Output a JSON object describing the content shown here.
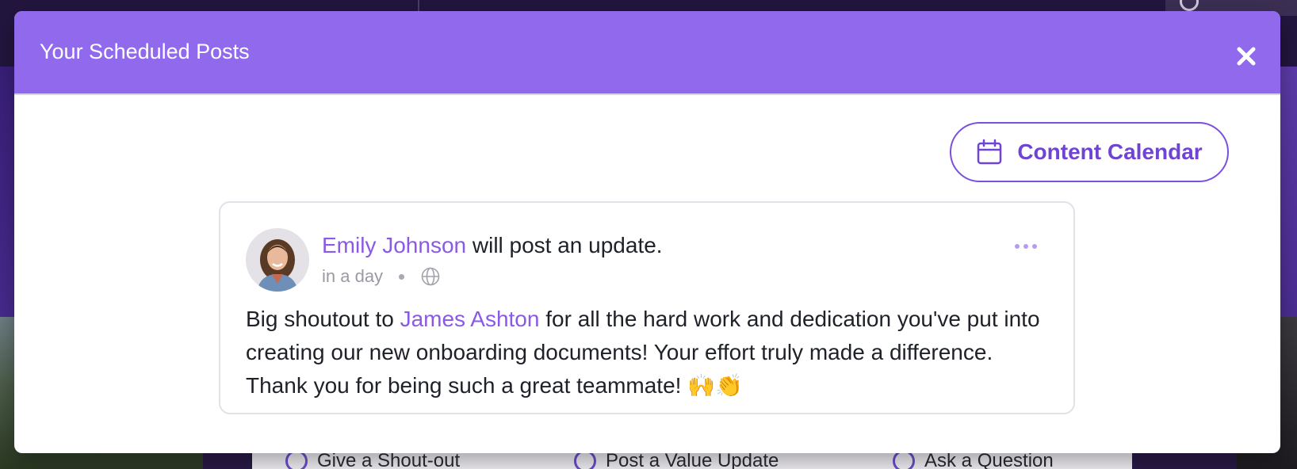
{
  "modal": {
    "title": "Your Scheduled Posts",
    "content_calendar_label": "Content Calendar"
  },
  "post": {
    "author": "Emily Johnson",
    "action_text": " will post an update.",
    "schedule_text": "in a day",
    "body_prefix": "Big shoutout to ",
    "mention": "James Ashton",
    "body_suffix": " for all the hard work and dedication you've put into creating our new onboarding documents! Your effort truly made a difference. Thank you for being such a great teammate! 🙌👏"
  },
  "background": {
    "actions": [
      "Give a Shout-out",
      "Post a Value Update",
      "Ask a Question"
    ]
  },
  "colors": {
    "header": "#9169ec",
    "accent": "#8a59e6",
    "button_border": "#7b4fe0"
  },
  "icons": [
    "close-icon",
    "calendar-icon",
    "globe-icon",
    "more-icon"
  ]
}
